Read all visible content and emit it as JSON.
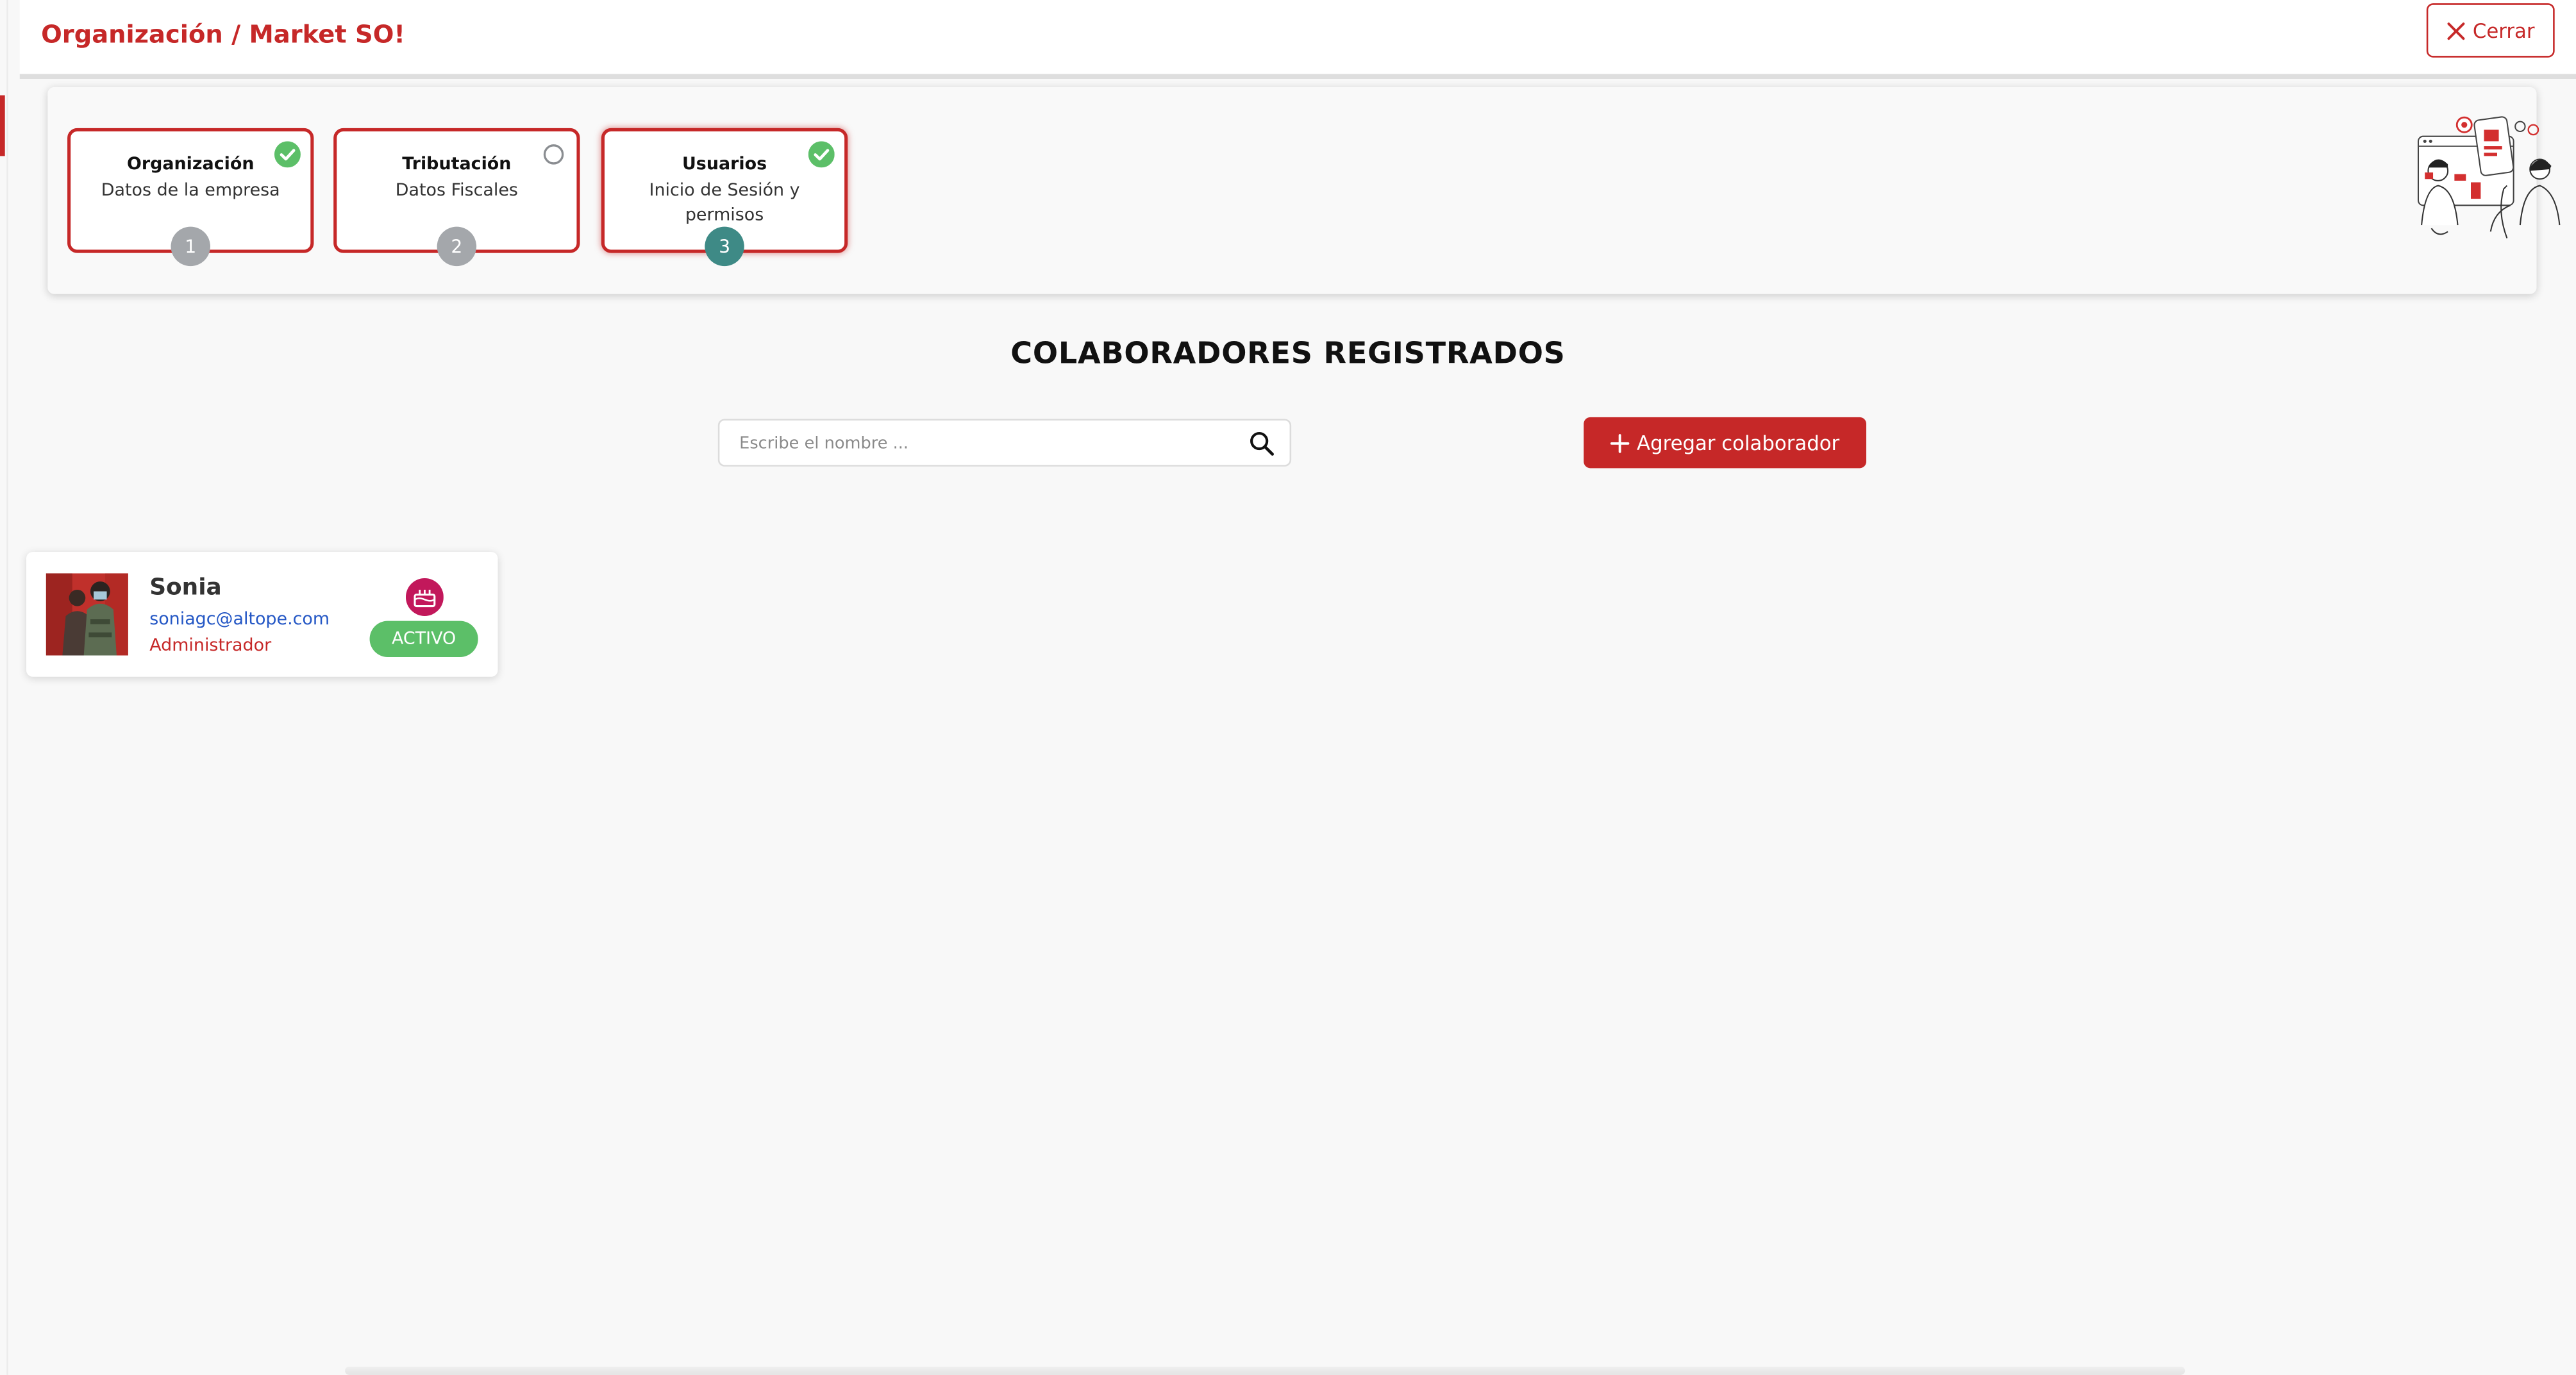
{
  "header": {
    "title": "Organización / Market SO!",
    "close_label": "Cerrar"
  },
  "steps": [
    {
      "title": "Organización",
      "subtitle": "Datos de la empresa",
      "number": "1",
      "status": "complete"
    },
    {
      "title": "Tributación",
      "subtitle": "Datos Fiscales",
      "number": "2",
      "status": "pending"
    },
    {
      "title": "Usuarios",
      "subtitle": "Inicio de Sesión y permisos",
      "number": "3",
      "status": "complete",
      "current": true
    }
  ],
  "main": {
    "section_title": "COLABORADORES REGISTRADOS",
    "search": {
      "placeholder": "Escribe el nombre ...",
      "value": ""
    },
    "add_button_label": "Agregar colaborador"
  },
  "users": [
    {
      "name": "Sonia",
      "email": "soniagc@altope.com",
      "role": "Administrador",
      "status": "ACTIVO"
    }
  ],
  "icons": {
    "close": "close-icon",
    "check": "check-circle-icon",
    "pending": "empty-circle-icon",
    "search": "search-icon",
    "add": "plus-icon",
    "birthday": "cake-icon"
  },
  "colors": {
    "brand": "#c62828",
    "success": "#5cbf68",
    "step_current": "#3e8a86",
    "step_default": "#a4a7ab",
    "link": "#2457c5"
  }
}
